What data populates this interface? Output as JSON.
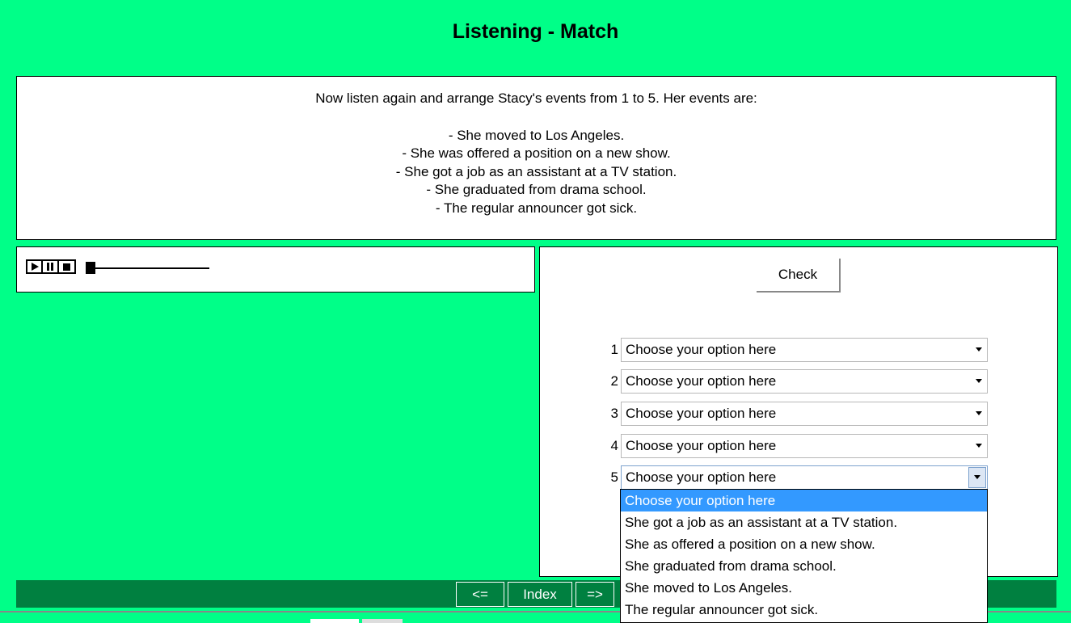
{
  "title": "Listening - Match",
  "instructions": {
    "intro": "Now listen again and arrange Stacy's events from 1 to 5. Her events are:",
    "events": [
      "- She moved to Los Angeles.",
      "- She was offered a position on a new show.",
      "- She got a job as an assistant at a TV station.",
      "- She graduated from drama school.",
      "- The regular announcer got sick."
    ]
  },
  "player": {
    "play_icon": "play-icon",
    "pause_icon": "pause-icon",
    "stop_icon": "stop-icon",
    "progress": 0
  },
  "check_label": "Check",
  "rows": [
    {
      "num": "1",
      "value": "Choose your option here"
    },
    {
      "num": "2",
      "value": "Choose your option here"
    },
    {
      "num": "3",
      "value": "Choose your option here"
    },
    {
      "num": "4",
      "value": "Choose your option here"
    },
    {
      "num": "5",
      "value": "Choose your option here"
    }
  ],
  "dropdown": {
    "options": [
      "Choose your option here",
      "She got a job as an assistant at a TV station.",
      "She as offered a position on a new show.",
      "She graduated from drama school.",
      "She moved to Los Angeles.",
      "The regular announcer got sick."
    ],
    "selected_index": 0
  },
  "nav": {
    "prev": "<=",
    "index": "Index",
    "next": "=>"
  },
  "colors": {
    "background": "#00ff88",
    "footer": "#008040",
    "highlight": "#3399ff"
  }
}
